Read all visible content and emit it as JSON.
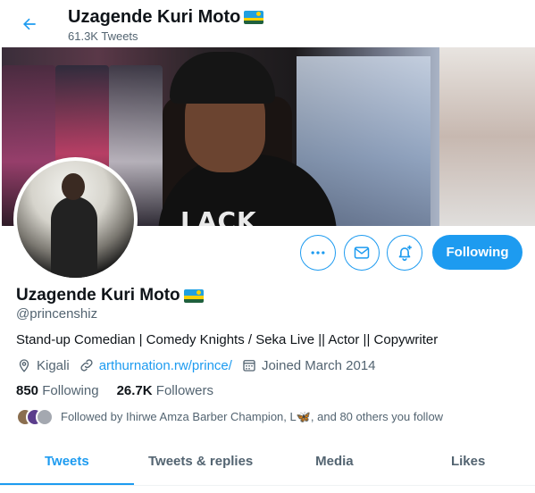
{
  "header": {
    "title": "Uzagende Kuri Moto",
    "tweets_count": "61.3K Tweets"
  },
  "banner": {
    "shirt_text": "LACK"
  },
  "actions": {
    "follow_label": "Following"
  },
  "profile": {
    "name": "Uzagende Kuri Moto",
    "handle": "@princenshiz",
    "bio": "Stand-up Comedian | Comedy Knights / Seka Live || Actor || Copywriter",
    "location": "Kigali",
    "website": "arthurnation.rw/prince/",
    "joined": "Joined March 2014",
    "following_count": "850",
    "following_label": "Following",
    "followers_count": "26.7K",
    "followers_label": "Followers",
    "followed_by_text": "Followed by Ihirwe Amza Barber Champion, L🦋, and 80 others you follow"
  },
  "tabs": [
    {
      "label": "Tweets",
      "active": true
    },
    {
      "label": "Tweets & replies",
      "active": false
    },
    {
      "label": "Media",
      "active": false
    },
    {
      "label": "Likes",
      "active": false
    }
  ],
  "colors": {
    "accent": "#1d9bf0",
    "text_primary": "#0f1419",
    "text_secondary": "#536471"
  }
}
